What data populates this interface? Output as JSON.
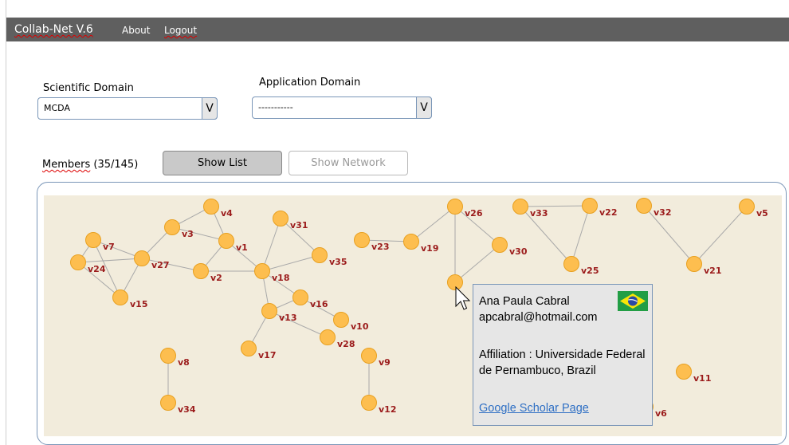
{
  "app": {
    "title": "Collab-Net V.6",
    "nav": [
      "About",
      "Logout"
    ]
  },
  "filters": {
    "scientific_label": "Scientific Domain",
    "scientific_value": "MCDA",
    "scientific_button": "V",
    "application_label": "Application Domain",
    "application_value": "-----------",
    "application_button": "V"
  },
  "members": {
    "label": "Members",
    "count": "(35/145)",
    "show_list": "Show List",
    "show_network": "Show Network"
  },
  "network": {
    "nodes": [
      {
        "id": "v1",
        "label": "v1"
      },
      {
        "id": "v2",
        "label": "v2"
      },
      {
        "id": "v3",
        "label": "v3"
      },
      {
        "id": "v4",
        "label": "v4"
      },
      {
        "id": "v5",
        "label": "v5"
      },
      {
        "id": "v6",
        "label": "v6"
      },
      {
        "id": "v7",
        "label": "v7"
      },
      {
        "id": "v8",
        "label": "v8"
      },
      {
        "id": "v9",
        "label": "v9"
      },
      {
        "id": "v10",
        "label": "v10"
      },
      {
        "id": "v11",
        "label": "v11"
      },
      {
        "id": "v12",
        "label": "v12"
      },
      {
        "id": "v13",
        "label": "v13"
      },
      {
        "id": "v15",
        "label": "v15"
      },
      {
        "id": "v16",
        "label": "v16"
      },
      {
        "id": "v17",
        "label": "v17"
      },
      {
        "id": "v18",
        "label": "v18"
      },
      {
        "id": "v19",
        "label": "v19"
      },
      {
        "id": "v21",
        "label": "v21"
      },
      {
        "id": "v22",
        "label": "v22"
      },
      {
        "id": "v23",
        "label": "v23"
      },
      {
        "id": "v24",
        "label": "v24"
      },
      {
        "id": "v25",
        "label": "v25"
      },
      {
        "id": "v26",
        "label": "v26"
      },
      {
        "id": "v27",
        "label": "v27"
      },
      {
        "id": "v28",
        "label": "v28"
      },
      {
        "id": "v30",
        "label": "v30"
      },
      {
        "id": "v31",
        "label": "v31"
      },
      {
        "id": "v32",
        "label": "v32"
      },
      {
        "id": "v33",
        "label": "v33"
      },
      {
        "id": "v34",
        "label": "v34"
      },
      {
        "id": "v35",
        "label": "v35"
      },
      {
        "id": "hovered",
        "label": ""
      }
    ],
    "edges": [
      [
        "v4",
        "v3"
      ],
      [
        "v4",
        "v1"
      ],
      [
        "v3",
        "v1"
      ],
      [
        "v3",
        "v27"
      ],
      [
        "v1",
        "v2"
      ],
      [
        "v1",
        "v18"
      ],
      [
        "v27",
        "v2"
      ],
      [
        "v2",
        "v18"
      ],
      [
        "v7",
        "v27"
      ],
      [
        "v7",
        "v24"
      ],
      [
        "v7",
        "v15"
      ],
      [
        "v24",
        "v27"
      ],
      [
        "v24",
        "v15"
      ],
      [
        "v27",
        "v15"
      ],
      [
        "v31",
        "v18"
      ],
      [
        "v31",
        "v35"
      ],
      [
        "v18",
        "v35"
      ],
      [
        "v18",
        "v16"
      ],
      [
        "v18",
        "v13"
      ],
      [
        "v16",
        "v13"
      ],
      [
        "v16",
        "v10"
      ],
      [
        "v13",
        "v17"
      ],
      [
        "v13",
        "v28"
      ],
      [
        "v8",
        "v34"
      ],
      [
        "v9",
        "v12"
      ],
      [
        "v23",
        "v19"
      ],
      [
        "v19",
        "v26"
      ],
      [
        "v26",
        "v30"
      ],
      [
        "v26",
        "hovered"
      ],
      [
        "v30",
        "hovered"
      ],
      [
        "v33",
        "v22"
      ],
      [
        "v33",
        "v25"
      ],
      [
        "v22",
        "v25"
      ],
      [
        "v32",
        "v21"
      ],
      [
        "v5",
        "v21"
      ]
    ]
  },
  "popup": {
    "name": "Ana Paula Cabral",
    "email": "apcabral@hotmail.com",
    "affiliation": "Affiliation : Universidade Federal de Pernambuco, Brazil",
    "link": "Google Scholar Page",
    "flag": "brazil-flag"
  },
  "colors": {
    "topbar": "#5f5f5f",
    "node_fill": "#fdbe4f",
    "node_label": "#9b1b1b",
    "canvas": "#f2ecdc",
    "link": "#2e6fc4"
  }
}
